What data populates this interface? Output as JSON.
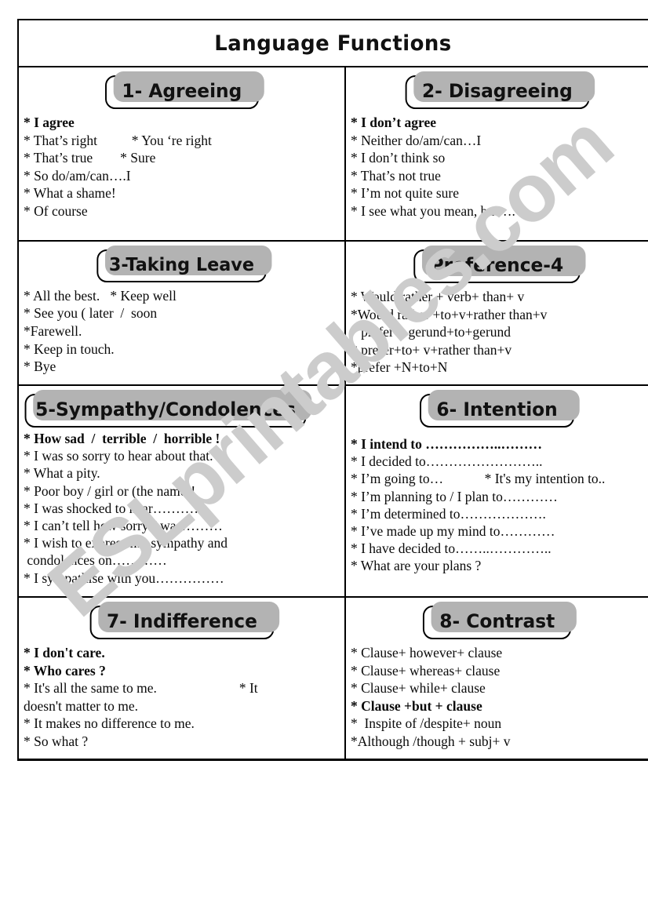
{
  "document": {
    "title": "Language Functions",
    "watermark": "ESLprintables.com",
    "colors": {
      "border": "#000000",
      "badge_shadow": "#b3b3b3",
      "watermark": "#cccccc",
      "text": "#0a0a0a",
      "background": "#ffffff"
    }
  },
  "sections": [
    {
      "id": "agreeing",
      "badge": "1- Agreeing",
      "badge_align": "center",
      "items": [
        {
          "text": "* I agree",
          "bold": true
        },
        {
          "text": "* That’s right          * You ‘re right",
          "bold": false
        },
        {
          "text": "* That’s true        * Sure",
          "bold": false
        },
        {
          "text": "* So do/am/can….I",
          "bold": false
        },
        {
          "text": "* What a shame!",
          "bold": false
        },
        {
          "text": "* Of course",
          "bold": false
        }
      ]
    },
    {
      "id": "disagreeing",
      "badge": "2- Disagreeing",
      "badge_align": "center",
      "items": [
        {
          "text": "* I don’t agree",
          "bold": true
        },
        {
          "text": "* Neither do/am/can…I",
          "bold": false
        },
        {
          "text": "* I don’t think so",
          "bold": false
        },
        {
          "text": "* That’s not true",
          "bold": false
        },
        {
          "text": "* I’m not quite sure",
          "bold": false
        },
        {
          "text": "* I see what you mean, but….",
          "bold": false
        }
      ]
    },
    {
      "id": "taking-leave",
      "badge": "3-Taking Leave",
      "badge_align": "center",
      "items": [
        {
          "text": "* All the best.   * Keep well",
          "bold": false
        },
        {
          "text": "* See you ( later  /  soon",
          "bold": false
        },
        {
          "text": "*Farewell.",
          "bold": false
        },
        {
          "text": "* Keep in touch.",
          "bold": false
        },
        {
          "text": "* Bye",
          "bold": false
        }
      ]
    },
    {
      "id": "preference",
      "badge": "Preference-4",
      "badge_align": "center",
      "items": [
        {
          "text": "* Would rather + verb+ than+ v",
          "bold": false
        },
        {
          "text": "*Would rather +to+v+rather than+v",
          "bold": false
        },
        {
          "text": "* prefer + gerund+to+gerund",
          "bold": false
        },
        {
          "text": "* prefer+to+ v+rather than+v",
          "bold": false
        },
        {
          "text": "*prefer +N+to+N",
          "bold": false
        }
      ]
    },
    {
      "id": "sympathy-condolences",
      "badge": "5-Sympathy/Condolences",
      "badge_align": "flushleft",
      "items": [
        {
          "text": "* How sad  /  terrible  /  horrible !",
          "bold": true
        },
        {
          "text": "* I was so sorry to hear about that.",
          "bold": false
        },
        {
          "text": "* What a pity.",
          "bold": false
        },
        {
          "text": "* Poor boy / girl or (the name)!",
          "bold": false
        },
        {
          "text": "* I was shocked to hear………….",
          "bold": false
        },
        {
          "text": "* I can’t tell how sorry I was………",
          "bold": false
        },
        {
          "text": "* I wish to express my sympathy and",
          "bold": false
        },
        {
          "text": " condolences on…………",
          "bold": false
        },
        {
          "text": "* I sympathise with you……………",
          "bold": false
        }
      ]
    },
    {
      "id": "intention",
      "badge": "6- Intention",
      "badge_align": "center",
      "items": [
        {
          "text": "* I intend to ……………..………",
          "bold": true
        },
        {
          "text": "* I decided to……………………..",
          "bold": false
        },
        {
          "text": "* I’m going to…            * It's my intention to..",
          "bold": false
        },
        {
          "text": "* I’m planning to / I plan to…………",
          "bold": false
        },
        {
          "text": "* I’m determined to……………….",
          "bold": false
        },
        {
          "text": "* I’ve made up my mind to…………",
          "bold": false
        },
        {
          "text": "* I have decided to……..…………..",
          "bold": false
        },
        {
          "text": "* What are your plans ?",
          "bold": false
        }
      ]
    },
    {
      "id": "indifference",
      "badge": "7- Indifference",
      "badge_align": "center",
      "items": [
        {
          "text": "* I don't care.",
          "bold": true
        },
        {
          "text": "* Who cares ?",
          "bold": true
        },
        {
          "text": "* It's all the same to me.                        * It",
          "bold": false
        },
        {
          "text": "doesn't matter to me.",
          "bold": false
        },
        {
          "text": "* It makes no difference to me.",
          "bold": false
        },
        {
          "text": "* So what ?",
          "bold": false
        }
      ]
    },
    {
      "id": "contrast",
      "badge": "8- Contrast",
      "badge_align": "center",
      "items": [
        {
          "text": "* Clause+ however+ clause",
          "bold": false
        },
        {
          "text": "* Clause+ whereas+ clause",
          "bold": false
        },
        {
          "text": "* Clause+ while+ clause",
          "bold": false
        },
        {
          "text": "* Clause +but + clause",
          "bold": true
        },
        {
          "text": "*  Inspite of /despite+ noun",
          "bold": false
        },
        {
          "text": "*Although /though + subj+ v",
          "bold": false
        }
      ]
    }
  ]
}
